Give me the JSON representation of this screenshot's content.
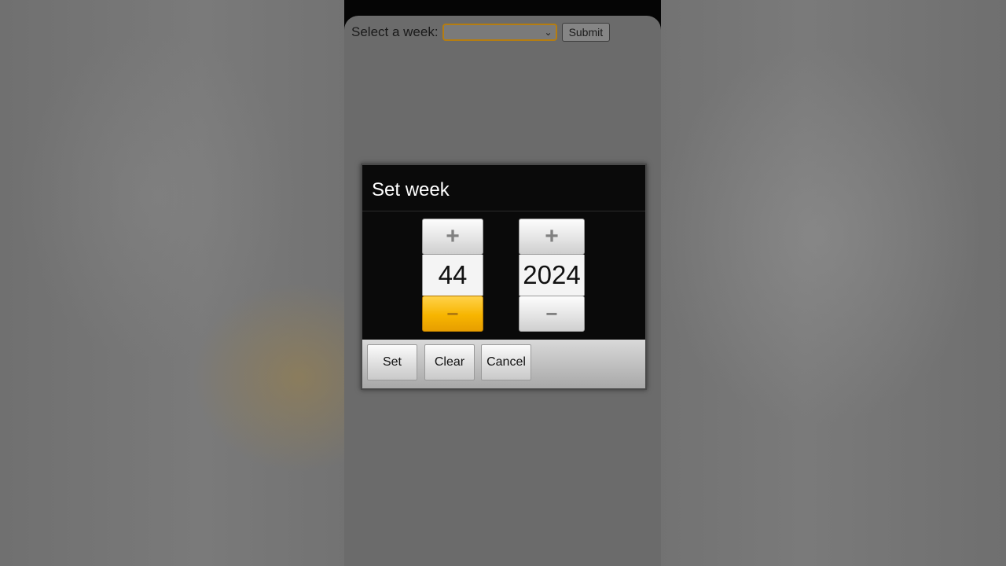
{
  "form": {
    "label": "Select a week:",
    "select_value": "",
    "select_chevron": "⌄",
    "submit_label": "Submit"
  },
  "dialog": {
    "title": "Set week",
    "week": {
      "value": "44",
      "plus": "+",
      "minus": "−"
    },
    "year": {
      "value": "2024",
      "plus": "+",
      "minus": "−"
    },
    "buttons": {
      "set": "Set",
      "clear": "Clear",
      "cancel": "Cancel"
    }
  },
  "colors": {
    "accent": "#f7b500",
    "select_border": "#b57d10"
  }
}
